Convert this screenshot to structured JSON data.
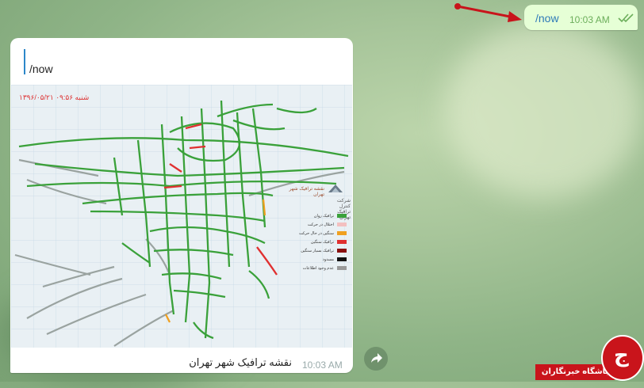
{
  "outgoing_message": {
    "text": "/now",
    "time": "10:03 AM",
    "status_icon": "double-check-icon"
  },
  "incoming_message": {
    "reply_quote": "/now",
    "map": {
      "date_stamp": "شنبه  ۰۹:۵۶  ۱۳۹۶/۰۵/۲۱",
      "title": "نقشه ترافیک شهر تهران",
      "logo_text": "شرکت کنترل ترافیک تهران",
      "legend": [
        {
          "label": "ترافیک روان",
          "color": "#3aa13a"
        },
        {
          "label": "اختلال در حرکت",
          "color": "#f3c0c0"
        },
        {
          "label": "سنگین در حال حرکت",
          "color": "#f0a020"
        },
        {
          "label": "ترافیک سنگین",
          "color": "#e03030"
        },
        {
          "label": "ترافیک بسیار سنگین",
          "color": "#8a1010"
        },
        {
          "label": "مسدود",
          "color": "#111111"
        },
        {
          "label": "عدم وجود اطلاعات",
          "color": "#999999"
        }
      ]
    },
    "caption": "نقشه ترافیک شهر تهران",
    "time": "10:03 AM"
  },
  "share_button": {
    "icon": "share-arrow-icon"
  },
  "watermark": {
    "text": "باشگاه خبرنگاران",
    "icon": "yjc-logo-icon"
  },
  "colors": {
    "accent_link": "#2e7ab8",
    "outgoing_bg": "#e6ffd6",
    "arrow": "#c8141b"
  }
}
